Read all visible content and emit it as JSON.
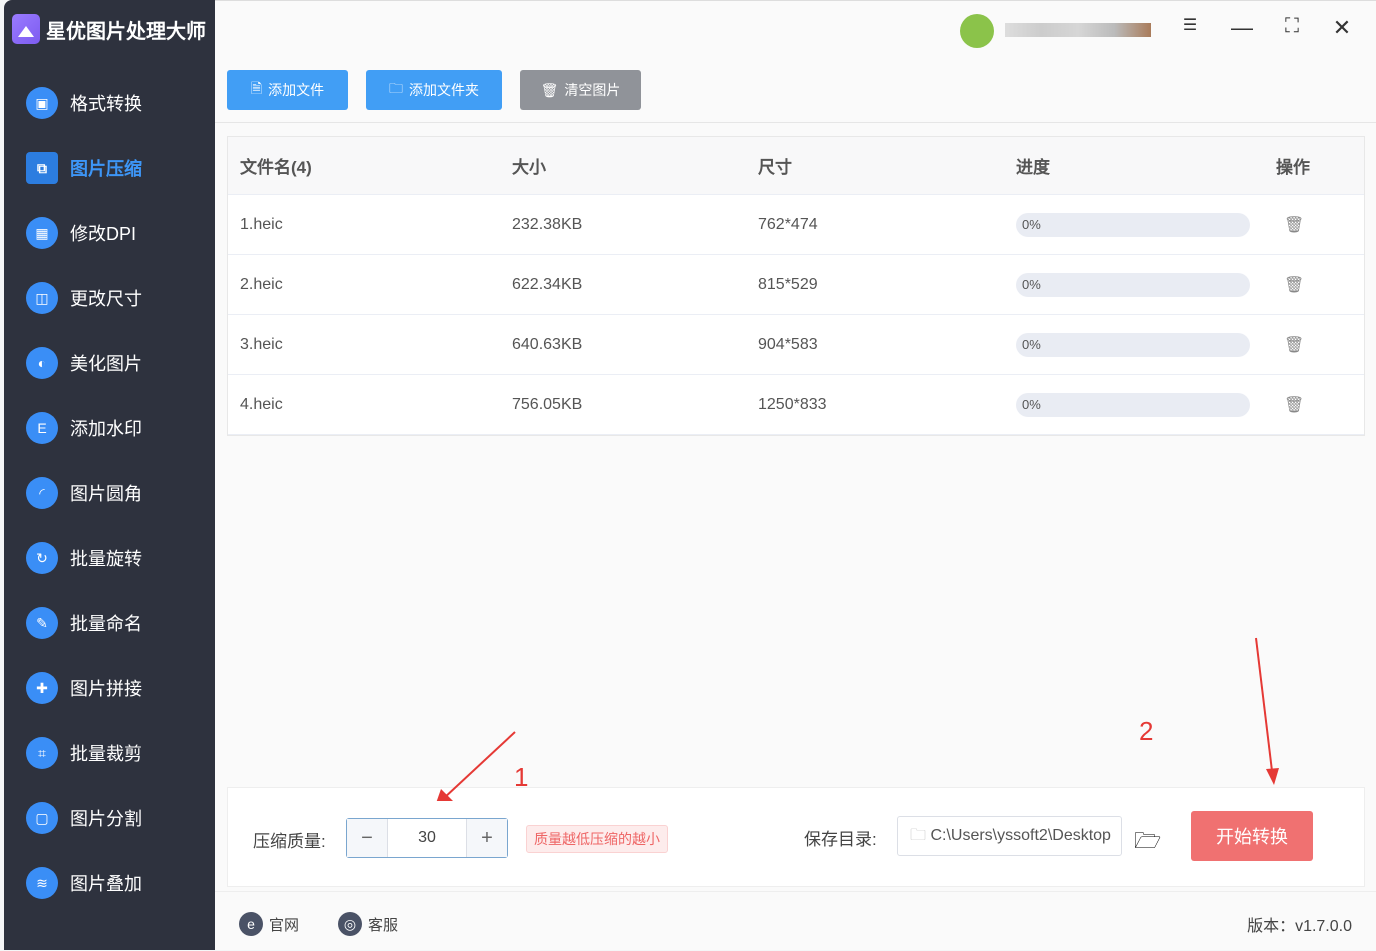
{
  "app": {
    "title": "星优图片处理大师"
  },
  "sidebar": {
    "items": [
      {
        "label": "格式转换",
        "icon": "image-convert-icon",
        "glyph": "▣"
      },
      {
        "label": "图片压缩",
        "icon": "image-compress-icon",
        "glyph": "⧉",
        "active": true
      },
      {
        "label": "修改DPI",
        "icon": "dpi-icon",
        "glyph": "▦"
      },
      {
        "label": "更改尺寸",
        "icon": "resize-icon",
        "glyph": "◫"
      },
      {
        "label": "美化图片",
        "icon": "beautify-icon",
        "glyph": "◐"
      },
      {
        "label": "添加水印",
        "icon": "watermark-icon",
        "glyph": "E"
      },
      {
        "label": "图片圆角",
        "icon": "rounded-corner-icon",
        "glyph": "◜"
      },
      {
        "label": "批量旋转",
        "icon": "rotate-icon",
        "glyph": "↻"
      },
      {
        "label": "批量命名",
        "icon": "rename-icon",
        "glyph": "✎"
      },
      {
        "label": "图片拼接",
        "icon": "puzzle-icon",
        "glyph": "✚"
      },
      {
        "label": "批量裁剪",
        "icon": "crop-icon",
        "glyph": "⌗"
      },
      {
        "label": "图片分割",
        "icon": "split-icon",
        "glyph": "▢"
      },
      {
        "label": "图片叠加",
        "icon": "layers-icon",
        "glyph": "≋"
      }
    ]
  },
  "toolbar": {
    "add_file": "添加文件",
    "add_folder": "添加文件夹",
    "clear": "清空图片"
  },
  "table": {
    "headers": [
      "文件名(4)",
      "大小",
      "尺寸",
      "进度",
      "操作"
    ],
    "rows": [
      {
        "name": "1.heic",
        "size": "232.38KB",
        "dims": "762*474",
        "progress": "0%"
      },
      {
        "name": "2.heic",
        "size": "622.34KB",
        "dims": "815*529",
        "progress": "0%"
      },
      {
        "name": "3.heic",
        "size": "640.63KB",
        "dims": "904*583",
        "progress": "0%"
      },
      {
        "name": "4.heic",
        "size": "756.05KB",
        "dims": "1250*833",
        "progress": "0%"
      }
    ]
  },
  "settings": {
    "quality_label": "压缩质量:",
    "quality_value": "30",
    "hint": "质量越低压缩的越小",
    "save_label": "保存目录:",
    "save_path": "C:\\Users\\yssoft2\\Desktop",
    "start": "开始转换"
  },
  "annotations": {
    "a1": "1",
    "a2": "2"
  },
  "footer": {
    "website": "官网",
    "support": "客服",
    "version": "版本：v1.7.0.0"
  },
  "colors": {
    "accent": "#419ef5",
    "start": "#f07171",
    "sidebar": "#2e323e"
  }
}
